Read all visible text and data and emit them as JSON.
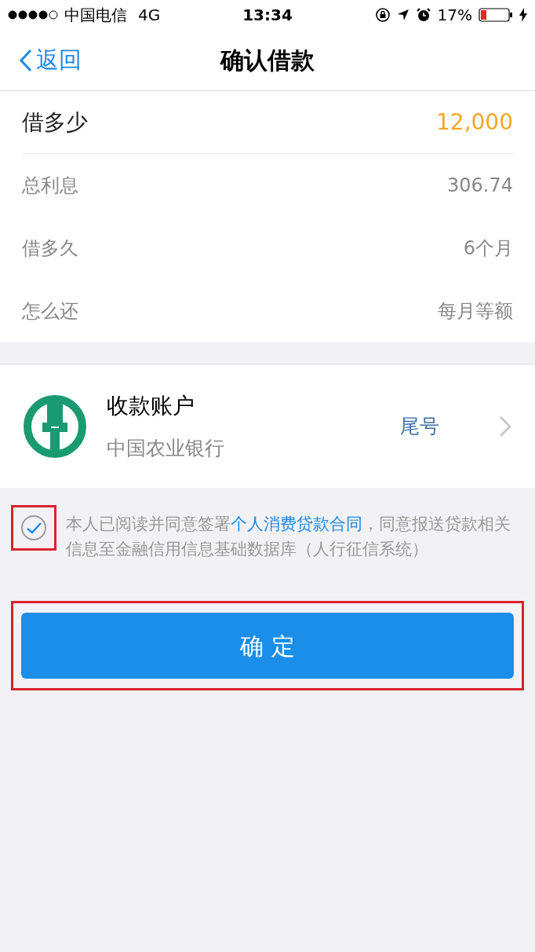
{
  "status_bar": {
    "carrier": "中国电信",
    "network": "4G",
    "time": "13:34",
    "battery": "17%"
  },
  "nav": {
    "back": "返回",
    "title": "确认借款"
  },
  "amount": {
    "label": "借多少",
    "value": "12,000"
  },
  "details": [
    {
      "label": "总利息",
      "value": "306.74"
    },
    {
      "label": "借多久",
      "value": "6个月"
    },
    {
      "label": "怎么还",
      "value": "每月等额"
    }
  ],
  "account": {
    "title": "收款账户",
    "bank": "中国农业银行",
    "tail": "尾号"
  },
  "agreement": {
    "checked": true,
    "highlighted": true,
    "before": "本人已阅读并同意签署",
    "link": "个人消费贷款合同",
    "after": "，同意报送贷款相关信息至金融信用信息基础数据库（人行征信系统）"
  },
  "confirm": {
    "label": "确 定",
    "highlighted": true
  }
}
